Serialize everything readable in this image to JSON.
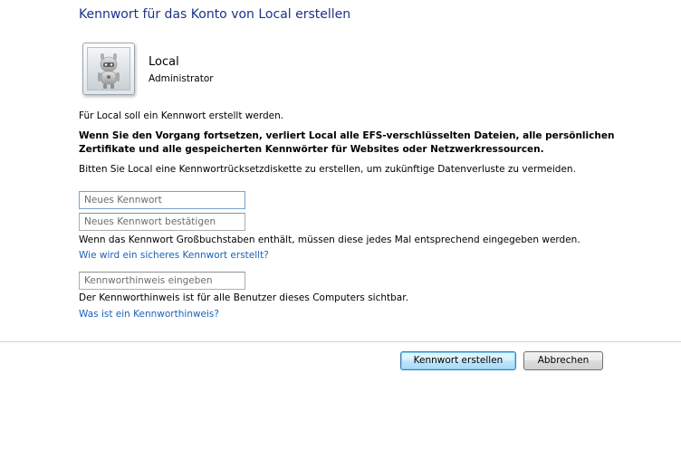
{
  "title": "Kennwort für das Konto von Local erstellen",
  "user": {
    "name": "Local",
    "role": "Administrator",
    "avatar_icon": "robot-user-icon"
  },
  "info": {
    "line1": "Für Local soll ein Kennwort erstellt werden.",
    "warning_line1": "Wenn Sie den Vorgang fortsetzen, verliert Local alle EFS-verschlüsselten Dateien, alle persönlichen",
    "warning_line2": "Zertifikate und alle gespeicherten Kennwörter für Websites oder Netzwerkressourcen.",
    "line3": "Bitten Sie Local eine Kennwortrücksetzdiskette zu erstellen, um zukünftige Datenverluste zu vermeiden."
  },
  "fields": {
    "new_password_placeholder": "Neues Kennwort",
    "confirm_password_placeholder": "Neues Kennwort bestätigen",
    "hint_placeholder": "Kennworthinweis eingeben"
  },
  "case_note": "Wenn das Kennwort Großbuchstaben enthält, müssen diese jedes Mal entsprechend eingegeben werden.",
  "secure_password_link": "Wie wird ein sicheres Kennwort erstellt?",
  "hint_note": "Der Kennworthinweis ist für alle Benutzer dieses Computers sichtbar.",
  "hint_link": "Was ist ein Kennworthinweis?",
  "buttons": {
    "create": "Kennwort erstellen",
    "cancel": "Abbrechen"
  },
  "colors": {
    "title": "#1e3287",
    "link": "#1a62b8"
  }
}
